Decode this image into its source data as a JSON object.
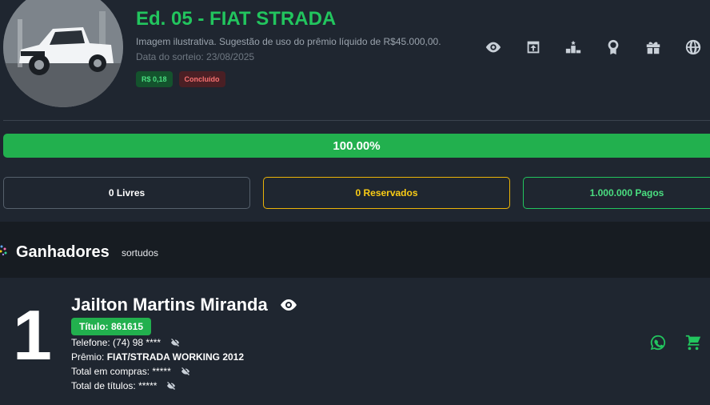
{
  "raffle": {
    "title": "Ed. 05 - FIAT STRADA",
    "description": "Imagem ilustrativa. Sugestão de uso do prêmio líquido de R$45.000,00.",
    "draw_date": "Data do sorteio: 23/08/2025",
    "price_badge": "R$ 0,18",
    "status_badge": "Concluído",
    "progress": 1.0,
    "progress_label": "100.00%"
  },
  "actions": [
    {
      "icon": "eye-icon"
    },
    {
      "icon": "open-in-new-icon"
    },
    {
      "icon": "podium-icon"
    },
    {
      "icon": "award-icon"
    },
    {
      "icon": "gift-icon"
    },
    {
      "icon": "globe-icon"
    }
  ],
  "stats": {
    "free": "0 Livres",
    "reserved": "0 Reservados",
    "paid": "1.000.000 Pagos"
  },
  "winners": {
    "title": "Ganhadores",
    "subtitle": "sortudos",
    "items": [
      {
        "rank": "1",
        "name": "Jailton Martins Miranda",
        "ticket": "Título: 861615",
        "phone_label": "Telefone:",
        "phone": "(74) 98 ****",
        "prize_label": "Prêmio:",
        "prize": "FIAT/STRADA WORKING 2012",
        "total_purchases_label": "Total em compras:",
        "total_purchases": "*****",
        "total_tickets_label": "Total de títulos:",
        "total_tickets": "*****"
      }
    ]
  },
  "colors": {
    "accent_green": "#22c55e",
    "reserved_yellow": "#eab308",
    "status_red": "#f87171",
    "background": "#1f2630"
  }
}
